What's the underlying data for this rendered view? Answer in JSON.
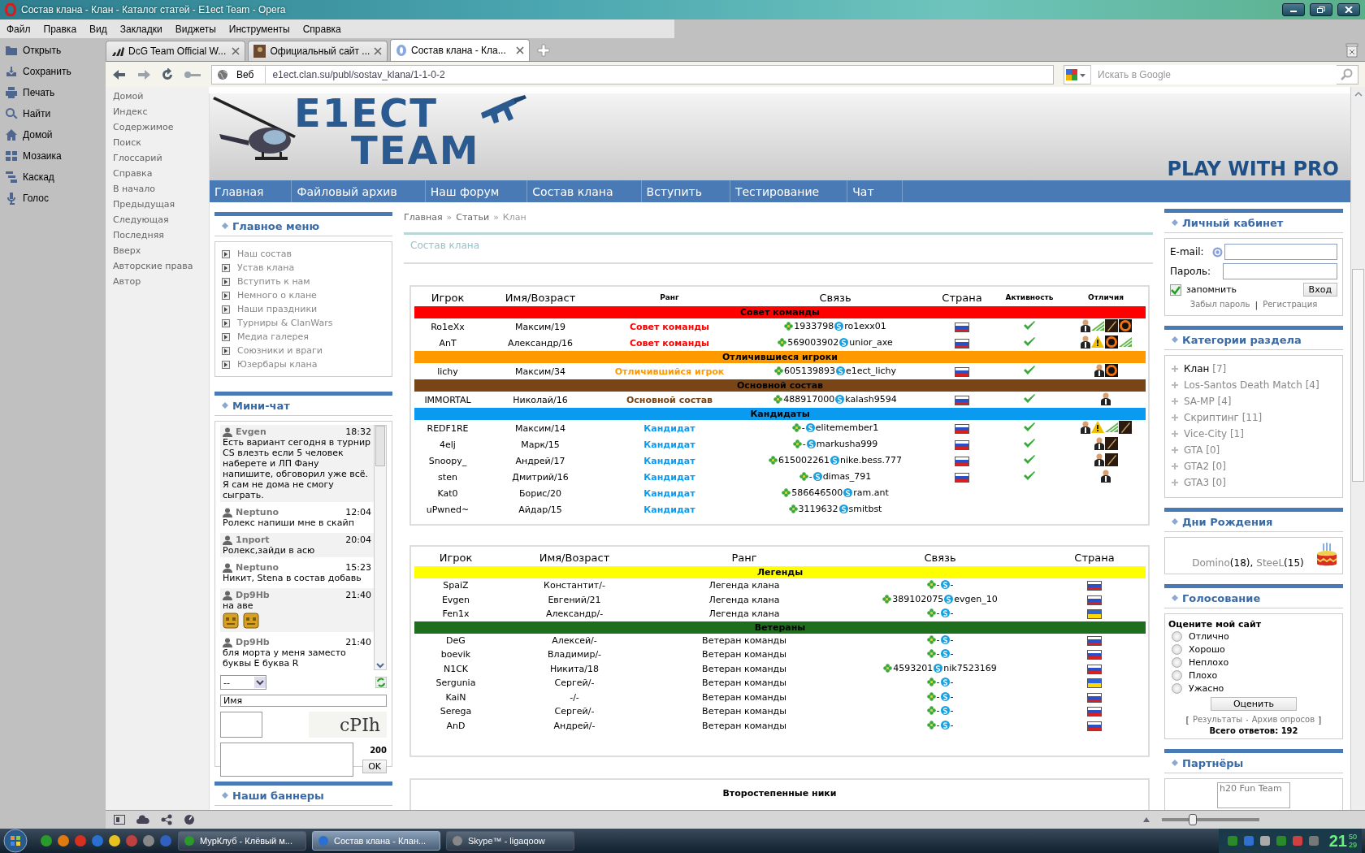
{
  "window": {
    "title": "Состав клана - Клан - Каталог статей - E1ect Team - Opera"
  },
  "menu": [
    "Файл",
    "Правка",
    "Вид",
    "Закладки",
    "Виджеты",
    "Инструменты",
    "Справка"
  ],
  "panel": [
    "Открыть",
    "Сохранить",
    "Печать",
    "Найти",
    "Домой",
    "Мозаика",
    "Каскад",
    "Голос"
  ],
  "tabs": [
    {
      "label": "DcG Team Official W...",
      "selected": false
    },
    {
      "label": "Официальный сайт ...",
      "selected": false
    },
    {
      "label": "Состав клана - Кла...",
      "selected": true
    }
  ],
  "address": {
    "mode": "Веб",
    "url": "e1ect.clan.su/publ/sostav_klana/1-1-0-2"
  },
  "search": {
    "placeholder": "Искать в Google"
  },
  "nav_links": [
    "Домой",
    "Индекс",
    "Содержимое",
    "Поиск",
    "Глоссарий",
    "Справка",
    "В начало",
    "Предыдущая",
    "Следующая",
    "Последняя",
    "Вверх",
    "Авторские права",
    "Автор"
  ],
  "site": {
    "logo": [
      "E1ECT",
      "TEAM"
    ],
    "slogan": "PLAY WITH PRO",
    "nav": [
      "Главная",
      "Файловый архив",
      "Наш форум",
      "Состав клана",
      "Вступить",
      "Тестирование",
      "Чат"
    ]
  },
  "main_menu": {
    "title": "Главное меню",
    "items": [
      "Наш состав",
      "Устав клана",
      "Вступить к нам",
      "Немного о клане",
      "Наши праздники",
      "Турниры & ClanWars",
      "Медиа галерея",
      "Союзники и враги",
      "Юзербары клана"
    ]
  },
  "mini_chat": {
    "title": "Мини-чат",
    "messages": [
      {
        "user": "Evgen",
        "time": "18:32",
        "text": "Есть вариант сегодня в турнир CS влезть если 5 человек наберете и ЛП Фану напишите, обговорил уже всё. Я сам не дома не смогу сыграть."
      },
      {
        "user": "Neptuno",
        "time": "12:04",
        "text": "Ролекс напиши мне в скайп"
      },
      {
        "user": "1nport",
        "time": "20:04",
        "text": "Ролекс,зайди в асю"
      },
      {
        "user": "Neptuno",
        "time": "15:23",
        "text": "Никит, Stena в состав добавь"
      },
      {
        "user": "Dp9Hb",
        "time": "21:40",
        "text": "на аве",
        "emoticons": [
          {
            "kind": "emoticon"
          },
          {
            "kind": "emoticon"
          }
        ]
      },
      {
        "user": "Dp9Hb",
        "time": "21:40",
        "text": "бля морта у меня заместо буквы Е буква R"
      }
    ],
    "select": "--",
    "name": "Имя",
    "captcha": "cPIh",
    "counter": "200",
    "button": "OK"
  },
  "banners": {
    "title": "Наши баннеры"
  },
  "breadcrumbs": [
    {
      "kind": "link",
      "text": "Главная"
    },
    {
      "kind": "text",
      "text": "»"
    },
    {
      "kind": "link",
      "text": "Статьи"
    },
    {
      "kind": "text",
      "text": "»"
    },
    {
      "kind": "text",
      "text": "Клан"
    }
  ],
  "page_title": "Состав клана",
  "roster": {
    "columns": [
      {
        "label": "Игрок",
        "small": false
      },
      {
        "label": "Имя/Возраст",
        "small": false
      },
      {
        "label": "Ранг",
        "small": true
      },
      {
        "label": "Связь",
        "small": false
      },
      {
        "label": "Страна",
        "small": false
      },
      {
        "label": "Активность",
        "small": true
      },
      {
        "label": "Отличия",
        "small": true
      }
    ],
    "groups": [
      {
        "title": "Совет команды",
        "color": "#ff0000",
        "rows": [
          {
            "player": "Ro1eXx",
            "name": "Максим/19",
            "rank": "Совет команды",
            "icq": "1933798",
            "skype": "ro1exx01",
            "flag": {
              "kind": "ru"
            },
            "active": true,
            "badges": [
              {
                "kind": "member"
              },
              {
                "kind": "stripes"
              },
              {
                "kind": "blade"
              },
              {
                "kind": "ring"
              }
            ]
          },
          {
            "player": "AnT",
            "name": "Александр/16",
            "rank": "Совет команды",
            "icq": "569003902",
            "skype": "unior_axe",
            "flag": {
              "kind": "ru"
            },
            "active": true,
            "badges": [
              {
                "kind": "member"
              },
              {
                "kind": "warning"
              },
              {
                "kind": "ring"
              },
              {
                "kind": "stripes"
              }
            ]
          }
        ]
      },
      {
        "title": "Отличившиеся игроки",
        "color": "#ff9900",
        "rows": [
          {
            "player": "lichy",
            "name": "Максим/34",
            "rank": "Отличившийся игрок",
            "icq": "605139893",
            "skype": "e1ect_lichy",
            "flag": {
              "kind": "ru"
            },
            "active": true,
            "badges": [
              {
                "kind": "member"
              },
              {
                "kind": "ring"
              }
            ]
          }
        ]
      },
      {
        "title": "Основной состав",
        "color": "#7a4516",
        "rows": [
          {
            "player": "IMMORTAL",
            "name": "Николай/16",
            "rank": "Основной состав",
            "icq": "488917000",
            "skype": "kalash9594",
            "flag": {
              "kind": "ru"
            },
            "active": true,
            "badges": [
              {
                "kind": "member"
              }
            ]
          }
        ]
      },
      {
        "title": "Кандидаты",
        "color": "#0a9af0",
        "rows": [
          {
            "player": "REDF1RE",
            "name": "Максим/14",
            "rank": "Кандидат",
            "icq": "-",
            "skype": "elitemember1",
            "flag": {
              "kind": "ru"
            },
            "active": true,
            "badges": [
              {
                "kind": "member"
              },
              {
                "kind": "warning"
              },
              {
                "kind": "stripes"
              },
              {
                "kind": "blade"
              }
            ]
          },
          {
            "player": "4elj",
            "name": "Марк/15",
            "rank": "Кандидат",
            "icq": "-",
            "skype": "markusha999",
            "flag": {
              "kind": "ru"
            },
            "active": true,
            "badges": [
              {
                "kind": "member"
              },
              {
                "kind": "blade"
              }
            ]
          },
          {
            "player": "Snoopy_",
            "name": "Андрей/17",
            "rank": "Кандидат",
            "icq": "615002261",
            "skype": "nike.bess.777",
            "flag": {
              "kind": "ru"
            },
            "active": true,
            "badges": [
              {
                "kind": "member"
              },
              {
                "kind": "blade"
              }
            ]
          },
          {
            "player": "sten",
            "name": "Дмитрий/16",
            "rank": "Кандидат",
            "icq": "-",
            "skype": "dimas_791",
            "flag": {
              "kind": "ru"
            },
            "active": true,
            "badges": [
              {
                "kind": "member"
              }
            ]
          },
          {
            "player": "Kat0",
            "name": "Борис/20",
            "rank": "Кандидат",
            "icq": "586646500",
            "skype": "ram.ant",
            "active": false,
            "badges": []
          },
          {
            "player": "uPwned~",
            "name": "Айдар/15",
            "rank": "Кандидат",
            "icq": "3119632",
            "skype": "smitbst",
            "active": false,
            "badges": []
          }
        ]
      }
    ]
  },
  "legends": {
    "columns": [
      "Игрок",
      "Имя/Возраст",
      "Ранг",
      "Связь",
      "Страна"
    ],
    "groups": [
      {
        "title": "Легенды",
        "color": "#ffff00",
        "rows": [
          {
            "player": "SpaiZ",
            "name": "Константит/-",
            "rank": "Легенда клана",
            "icq": "-",
            "skype": "-",
            "flag": {
              "kind": "ru"
            }
          },
          {
            "player": "Evgen",
            "name": "Евгений/21",
            "rank": "Легенда клана",
            "icq": "389102075",
            "skype": "evgen_10",
            "flag": {
              "kind": "ru"
            }
          },
          {
            "player": "Fen1x",
            "name": "Александр/-",
            "rank": "Легенда клана",
            "icq": "-",
            "skype": "-",
            "flag": {
              "kind": "ua"
            }
          }
        ]
      },
      {
        "title": "Ветераны",
        "color": "#1e6e1e",
        "rows": [
          {
            "player": "DeG",
            "name": "Алексей/-",
            "rank": "Ветеран команды",
            "icq": "-",
            "skype": "-",
            "flag": {
              "kind": "ru"
            }
          },
          {
            "player": "boevik",
            "name": "Владимир/-",
            "rank": "Ветеран команды",
            "icq": "-",
            "skype": "-",
            "flag": {
              "kind": "ru"
            }
          },
          {
            "player": "N1CK",
            "name": "Никита/18",
            "rank": "Ветеран команды",
            "icq": "4593201",
            "skype": "nik7523169",
            "flag": {
              "kind": "ru"
            }
          },
          {
            "player": "Sergunia",
            "name": "Сергей/-",
            "rank": "Ветеран команды",
            "icq": "-",
            "skype": "-",
            "flag": {
              "kind": "ua"
            }
          },
          {
            "player": "KaiN",
            "name": "-/-",
            "rank": "Ветеран команды",
            "icq": "-",
            "skype": "-",
            "flag": {
              "kind": "ru"
            }
          },
          {
            "player": "Serega",
            "name": "Сергей/-",
            "rank": "Ветеран команды",
            "icq": "-",
            "skype": "-",
            "flag": {
              "kind": "ru"
            }
          },
          {
            "player": "AnD",
            "name": "Андрей/-",
            "rank": "Ветеран команды",
            "icq": "-",
            "skype": "-",
            "flag": {
              "kind": "ru"
            }
          }
        ]
      }
    ]
  },
  "secondary": {
    "title": "Второстепенные ники"
  },
  "login": {
    "title": "Личный кабинет",
    "email_label": "E-mail:",
    "password_label": "Пароль:",
    "remember": {
      "label": "запомнить",
      "checked": true
    },
    "button": "Вход",
    "links": [
      {
        "kind": "link",
        "text": "Забыл пароль"
      },
      {
        "kind": "text",
        "text": "|"
      },
      {
        "kind": "link",
        "text": "Регистрация"
      }
    ]
  },
  "categories": {
    "title": "Категории раздела",
    "items": [
      {
        "name": "Клан",
        "count": "[7]",
        "selected": true
      },
      {
        "name": "Los-Santos Death Match",
        "count": "[4]",
        "selected": false
      },
      {
        "name": "SA-MP",
        "count": "[4]",
        "selected": false
      },
      {
        "name": "Скриптинг",
        "count": "[11]",
        "selected": false
      },
      {
        "name": "Vice-City",
        "count": "[1]",
        "selected": false
      },
      {
        "name": "GTA",
        "count": "[0]",
        "selected": false
      },
      {
        "name": "GTA2",
        "count": "[0]",
        "selected": false
      },
      {
        "name": "GTA3",
        "count": "[0]",
        "selected": false
      }
    ]
  },
  "birthdays": {
    "title": "Дни Рождения",
    "people": [
      {
        "name": "Domino",
        "age": "(18)"
      },
      {
        "name": "SteeL",
        "age": "(15)"
      }
    ],
    "separator": ","
  },
  "poll": {
    "title": "Голосование",
    "question": "Оцените мой сайт",
    "options": [
      {
        "label": "Отлично",
        "selected": false
      },
      {
        "label": "Хорошо",
        "selected": false
      },
      {
        "label": "Неплохо",
        "selected": false
      },
      {
        "label": "Плохо",
        "selected": false
      },
      {
        "label": "Ужасно",
        "selected": false
      }
    ],
    "button": "Оценить",
    "links": [
      {
        "kind": "text",
        "text": "["
      },
      {
        "kind": "link",
        "text": "Результаты"
      },
      {
        "kind": "text",
        "text": "·"
      },
      {
        "kind": "link",
        "text": "Архив опросов"
      },
      {
        "kind": "text",
        "text": "]"
      }
    ],
    "total": "Всего ответов: **192**"
  },
  "partners": {
    "title": "Партнёры",
    "banner": "h20 Fun Team"
  },
  "status_bar": {
    "zoom": {
      "level": 0.32
    }
  },
  "taskbar": {
    "tasks": [
      {
        "label": "МурКлуб - Клёвый м...",
        "selected": false
      },
      {
        "label": "Состав клана - Клан...",
        "selected": true
      },
      {
        "label": "Skype™ - ligaqoow",
        "selected": false
      }
    ],
    "clock": {
      "hours": "21",
      "minutes": "50",
      "seconds": "29"
    }
  }
}
